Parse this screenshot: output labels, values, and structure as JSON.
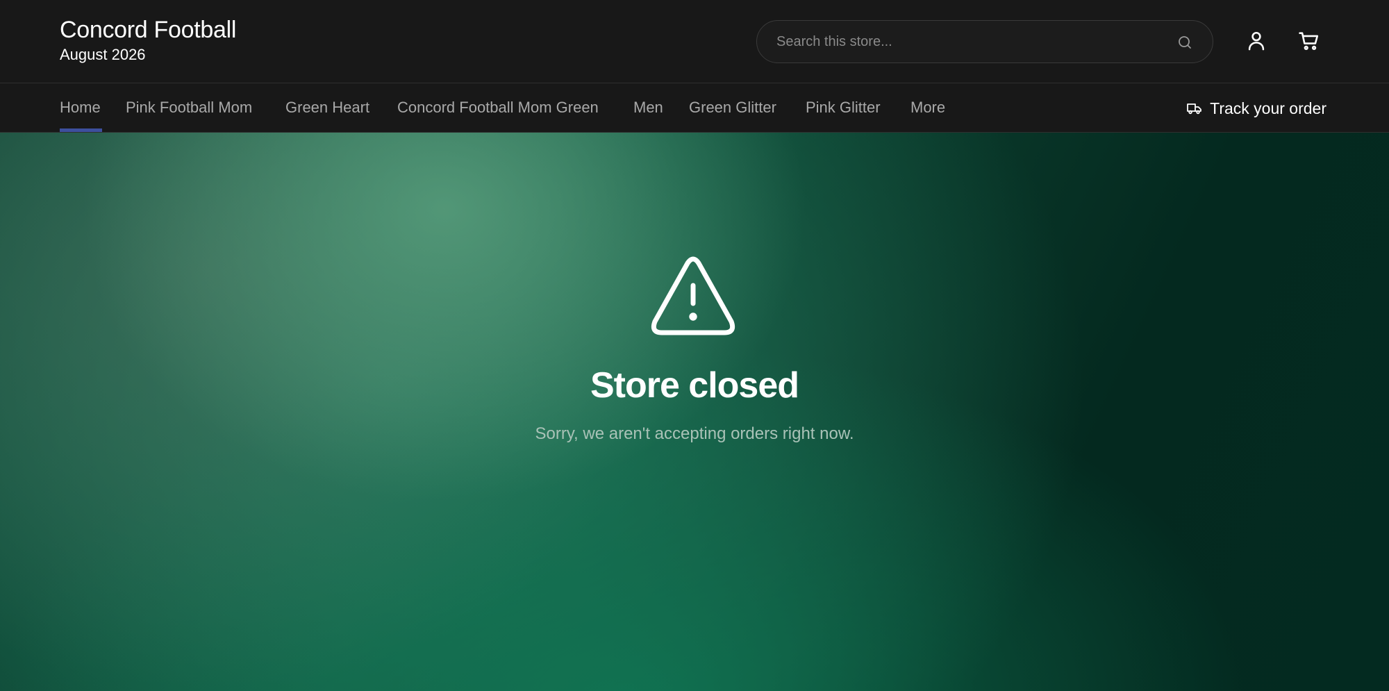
{
  "brand": {
    "title": "Concord Football",
    "subtitle": "August 2026"
  },
  "search": {
    "placeholder": "Search this store..."
  },
  "header_icons": [
    "search-icon",
    "account-icon",
    "cart-icon"
  ],
  "nav": {
    "items": [
      {
        "label": "Home",
        "active": true
      },
      {
        "label": "Pink Football Mom"
      },
      {
        "label": "Green Heart"
      },
      {
        "label": "Concord Football Mom Green"
      },
      {
        "label": "Men"
      },
      {
        "label": "Green Glitter"
      },
      {
        "label": "Pink Glitter"
      },
      {
        "label": "More"
      }
    ],
    "track_label": "Track your order",
    "active_color": "#3d4f9e"
  },
  "hero": {
    "icon": "warning-icon",
    "title": "Store closed",
    "message": "Sorry, we aren't accepting orders right now."
  }
}
